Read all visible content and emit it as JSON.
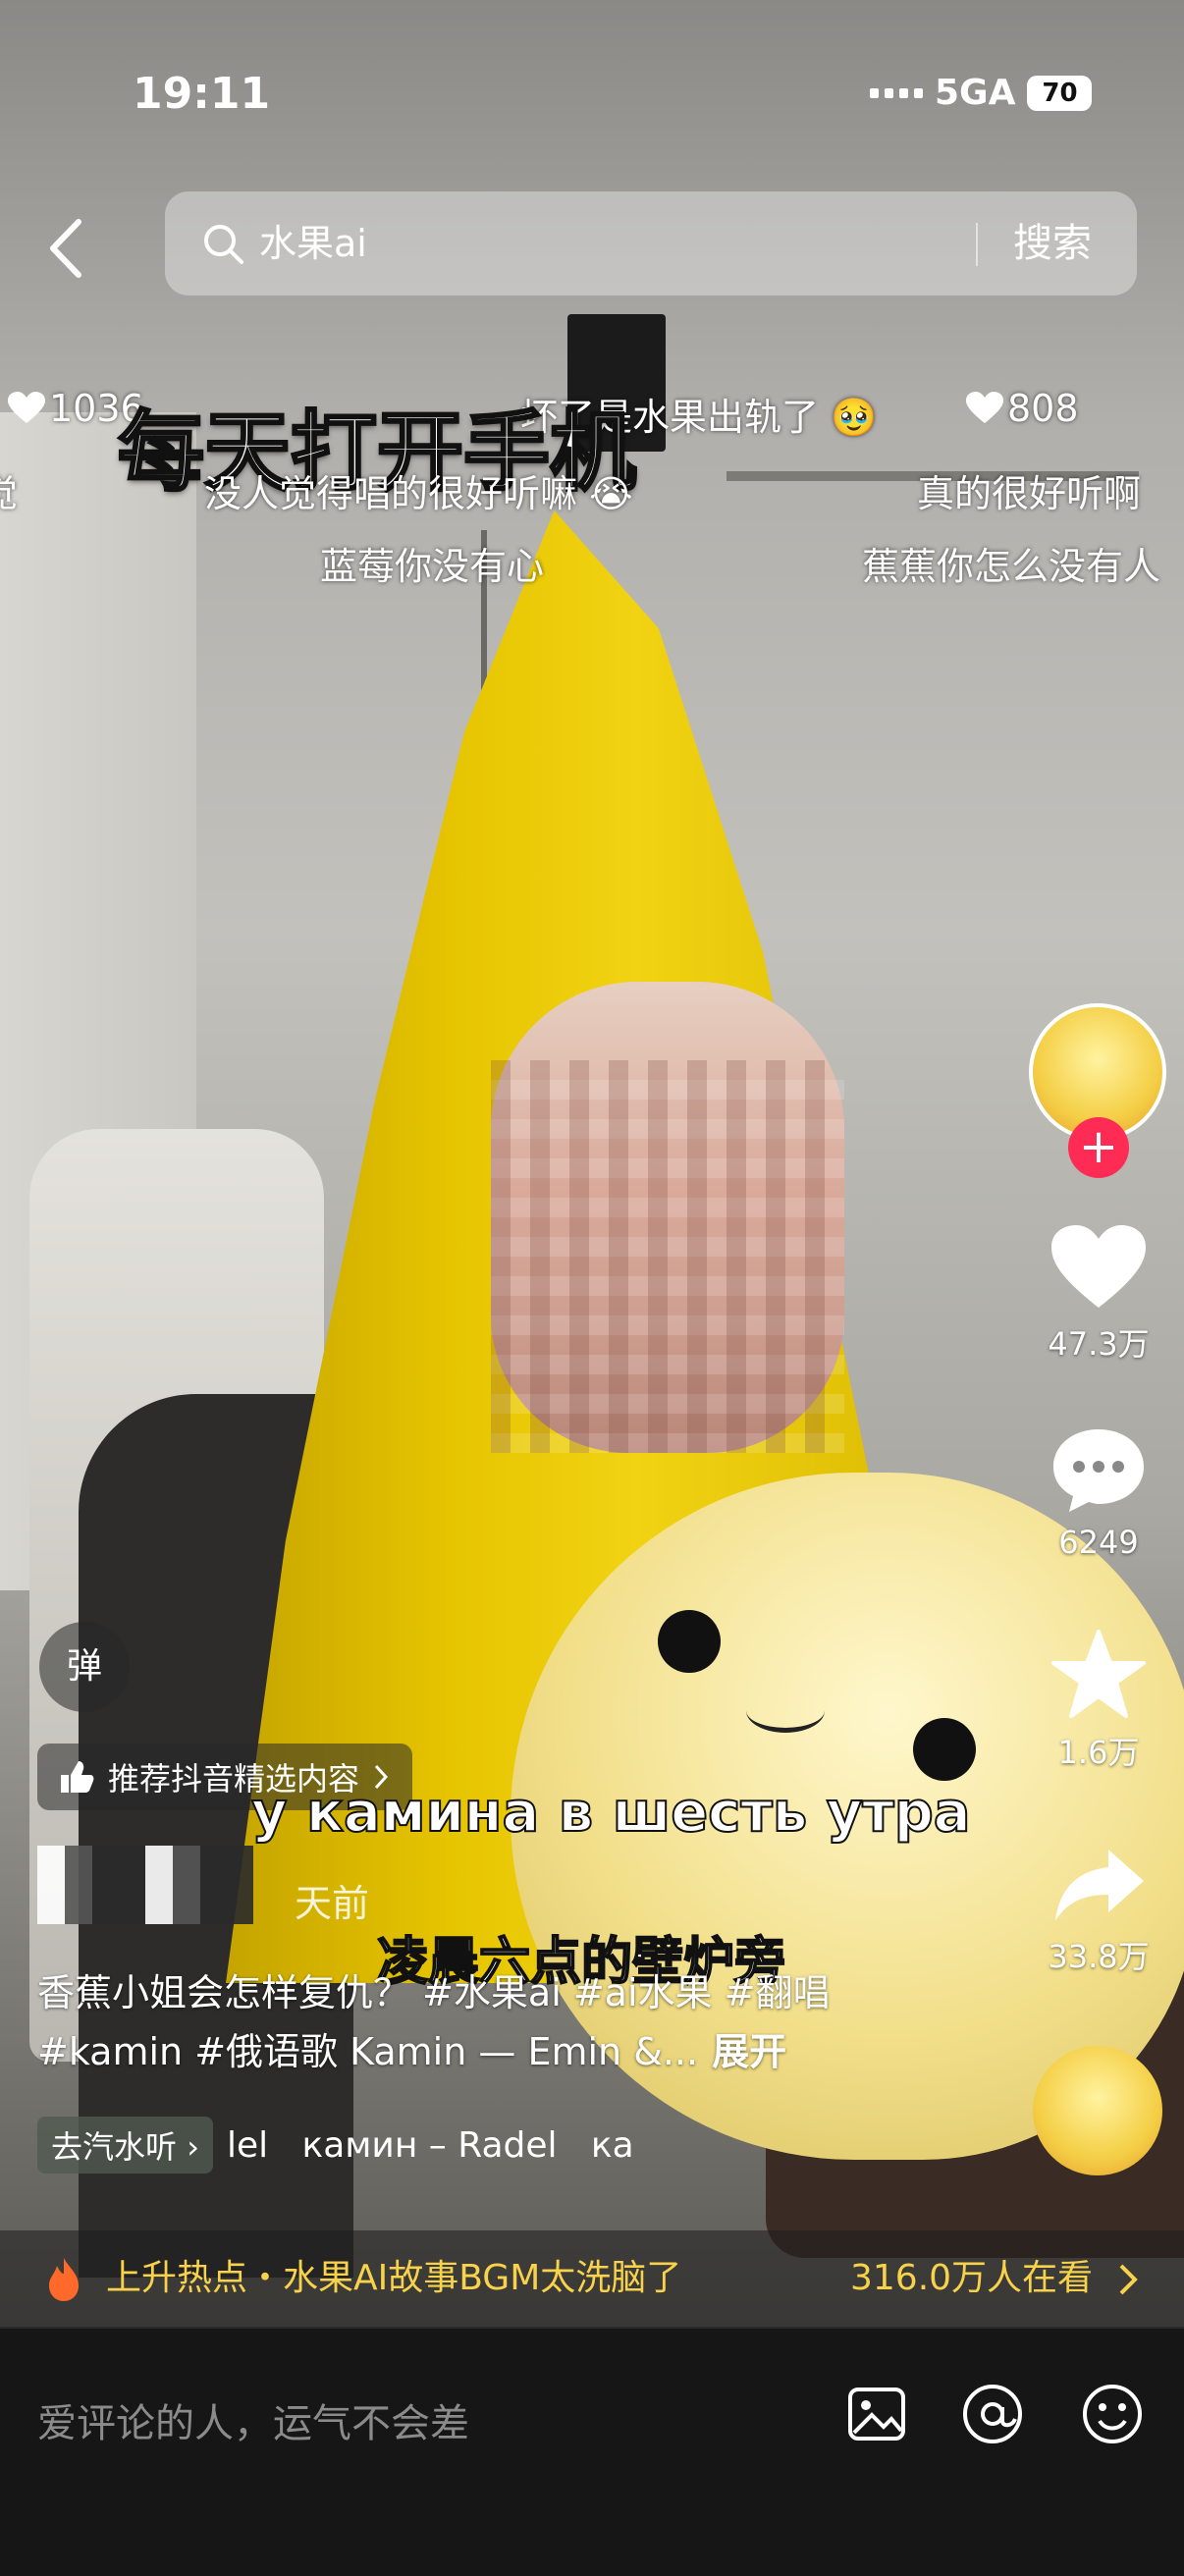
{
  "status_bar": {
    "time": "19:11",
    "network": "5GA",
    "battery": "70"
  },
  "search": {
    "query": "水果ai",
    "button": "搜索"
  },
  "danmaku": {
    "left_count": "1036",
    "top_center": "坏了是水果出轨了",
    "right_count": "808",
    "line2_left": "没人觉得唱的很好听嘛",
    "line2_right": "真的很好听啊",
    "line3_left": "蓝莓你没有心",
    "line3_right": "蕉蕉你怎么没有人",
    "edge": "觉",
    "big_caption": "每天打开手机"
  },
  "sidebar": {
    "likes": "47.3万",
    "comments": "6249",
    "favorites": "1.6万",
    "shares": "33.8万"
  },
  "video": {
    "danmaku_toggle": "弹",
    "recommend": "推荐抖音精选内容",
    "subtitle_ru": "у камина в шесть утра",
    "subtitle_cn": "凌晨六点的壁炉旁",
    "time_ago": "天前",
    "description": "香蕉小姐会怎样复仇？ #水果ai #ai水果 #翻唱 #kamin #俄语歌 Kamin — Emin &...",
    "expand": "展开",
    "music_tag": "去汽水听",
    "music_scroll": "lel   камин – Radel   ка"
  },
  "hot": {
    "text": "上升热点・水果AI故事BGM太洗脑了",
    "viewers": "316.0万人在看"
  },
  "comment_bar": {
    "placeholder": "爱评论的人，运气不会差"
  },
  "colors": {
    "accent_red": "#fe2c55",
    "hot_yellow": "#f7d24a"
  }
}
